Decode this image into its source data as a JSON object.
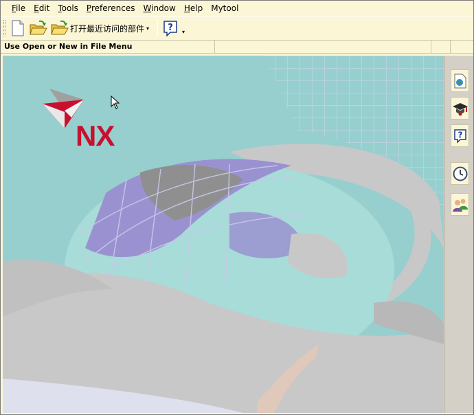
{
  "menu": [
    {
      "label": "File",
      "mnemonic": "F",
      "rest": "ile"
    },
    {
      "label": "Edit",
      "mnemonic": "E",
      "rest": "dit"
    },
    {
      "label": "Tools",
      "mnemonic": "T",
      "rest": "ools"
    },
    {
      "label": "Preferences",
      "mnemonic": "P",
      "rest": "references"
    },
    {
      "label": "Window",
      "mnemonic": "W",
      "rest": "indow"
    },
    {
      "label": "Help",
      "mnemonic": "H",
      "rest": "elp"
    },
    {
      "label": "Mytool",
      "mnemonic": "",
      "rest": "Mytool"
    }
  ],
  "toolbar": {
    "new_icon": "new-document-icon",
    "open_icon": "open-folder-icon",
    "recent_icon": "open-folder-icon",
    "recent_label": "打开最近访问的部件",
    "recent_arrow": "▾",
    "help_icon": "help-question-icon",
    "help_arrow": "▾"
  },
  "status": {
    "message": "Use Open or New in File Menu"
  },
  "graphics": {
    "logo_text": "NX"
  },
  "resource_bar": [
    {
      "icon": "web-browser-icon"
    },
    {
      "icon": "training-cap-icon"
    },
    {
      "icon": "help-question-icon"
    },
    {
      "icon": "history-clock-icon"
    },
    {
      "icon": "roles-users-icon"
    }
  ],
  "colors": {
    "chrome": "#fbf6d6",
    "graphics_bg": "#97cfcf",
    "nx_red": "#c8102e",
    "globe_purple": "#9a92d0"
  }
}
